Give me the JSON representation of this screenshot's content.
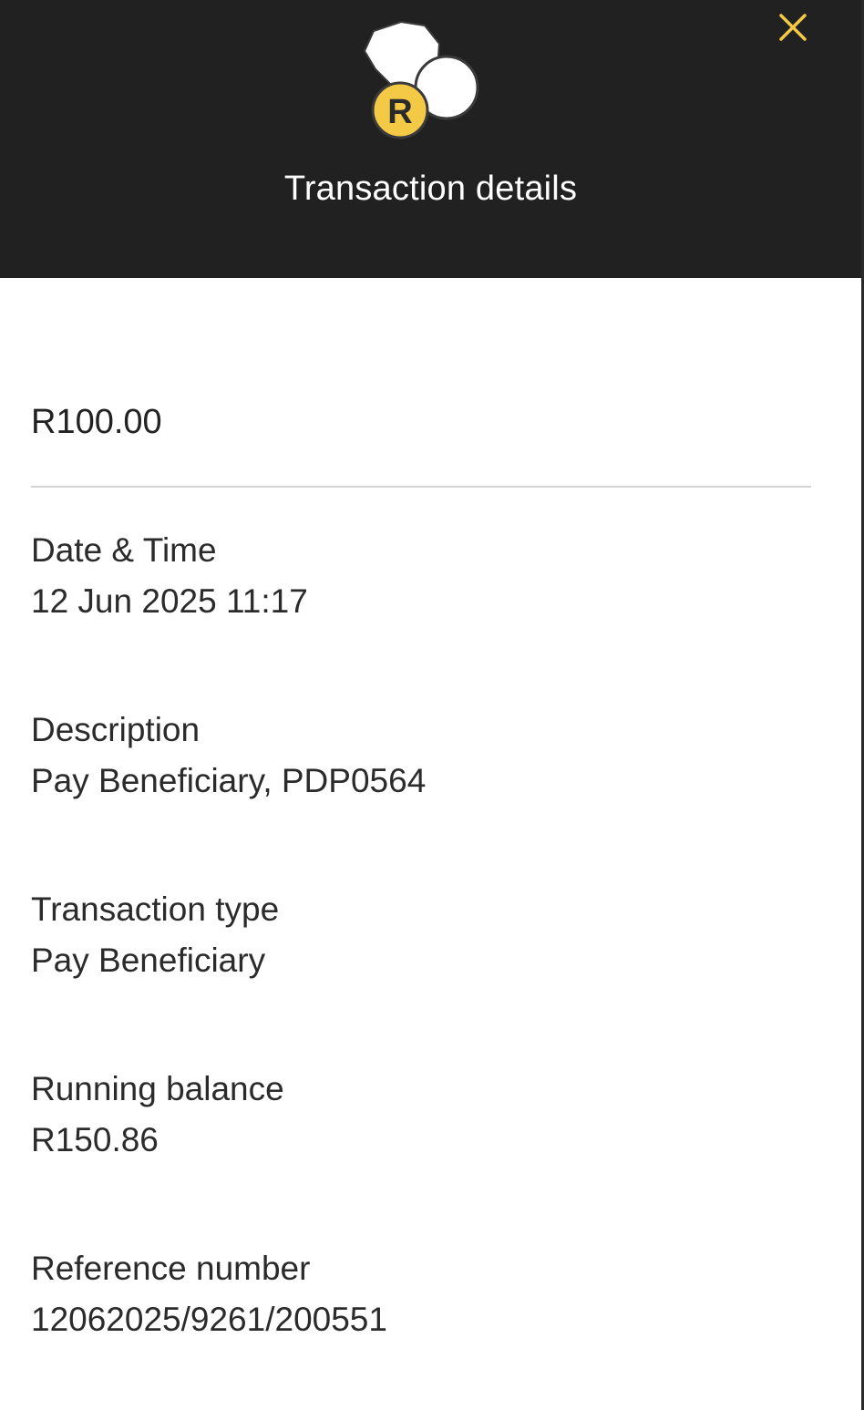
{
  "header": {
    "title": "Transaction details",
    "close_icon": "close-icon",
    "logo_icon": "coins-rand-icon",
    "logo_letter": "R",
    "background_color": "#222122",
    "accent_color": "#F3C945"
  },
  "transaction": {
    "amount": "R100.00",
    "fields": [
      {
        "label": "Date & Time",
        "value": "12 Jun 2025 11:17"
      },
      {
        "label": "Description",
        "value": "Pay Beneficiary, PDP0564"
      },
      {
        "label": "Transaction type",
        "value": "Pay Beneficiary"
      },
      {
        "label": "Running balance",
        "value": "R150.86"
      },
      {
        "label": "Reference number",
        "value": "12062025/9261/200551"
      }
    ]
  }
}
